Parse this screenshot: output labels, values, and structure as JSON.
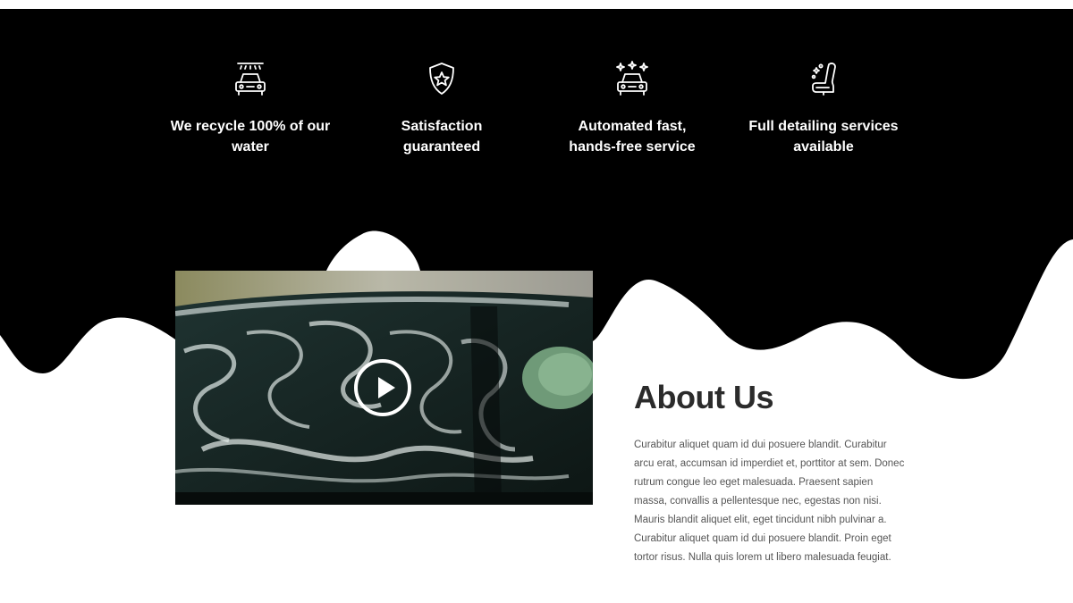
{
  "features": [
    {
      "icon": "car-wash-icon",
      "label_line1": "We recycle 100% of our",
      "label_line2": "water"
    },
    {
      "icon": "shield-star-icon",
      "label_line1": "Satisfaction",
      "label_line2": "guaranteed"
    },
    {
      "icon": "sparkling-car-icon",
      "label_line1": "Automated fast,",
      "label_line2": "hands-free service"
    },
    {
      "icon": "car-seat-icon",
      "label_line1": "Full detailing services",
      "label_line2": "available"
    }
  ],
  "video": {
    "play_icon": "play-icon"
  },
  "about": {
    "title": "About Us",
    "body": "Curabitur aliquet quam id dui posuere blandit. Curabitur arcu erat, accumsan id imperdiet et, porttitor at sem. Donec rutrum congue leo eget malesuada. Praesent sapien massa, convallis a pellentesque nec, egestas non nisi. Mauris blandit aliquet elit, eget tincidunt nibh pulvinar a. Curabitur aliquet quam id dui posuere blandit. Proin eget tortor risus. Nulla quis lorem ut libero malesuada feugiat."
  },
  "colors": {
    "background_dark": "#000000",
    "background_light": "#ffffff",
    "heading": "#2b2b2b",
    "body_text": "#555555"
  }
}
